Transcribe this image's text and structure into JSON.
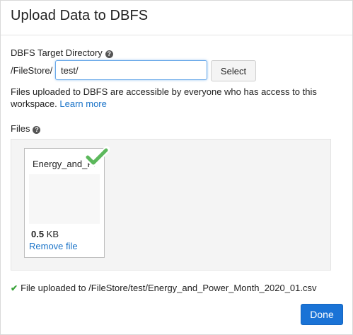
{
  "dialog": {
    "title": "Upload Data to DBFS"
  },
  "target_directory": {
    "label": "DBFS Target Directory",
    "help_icon": "question-circle-icon",
    "prefix": "/FileStore/",
    "value": "test/",
    "select_label": "Select",
    "info_text": "Files uploaded to DBFS are accessible by everyone who has access to this workspace.",
    "learn_more_label": "Learn more"
  },
  "files": {
    "label": "Files",
    "help_icon": "question-circle-icon",
    "items": [
      {
        "name": "Energy_and_Power_Month_2020_01.csv",
        "size_value": "0.5",
        "size_unit": "KB",
        "remove_label": "Remove file",
        "status_icon": "check-icon",
        "status_color": "#5cb85c"
      }
    ]
  },
  "status": {
    "icon": "check-icon",
    "text": "File uploaded to /FileStore/test/Energy_and_Power_Month_2020_01.csv"
  },
  "footer": {
    "done_label": "Done"
  },
  "colors": {
    "accent": "#1a73d6",
    "link": "#1a73c8",
    "success": "#3aa33a"
  }
}
